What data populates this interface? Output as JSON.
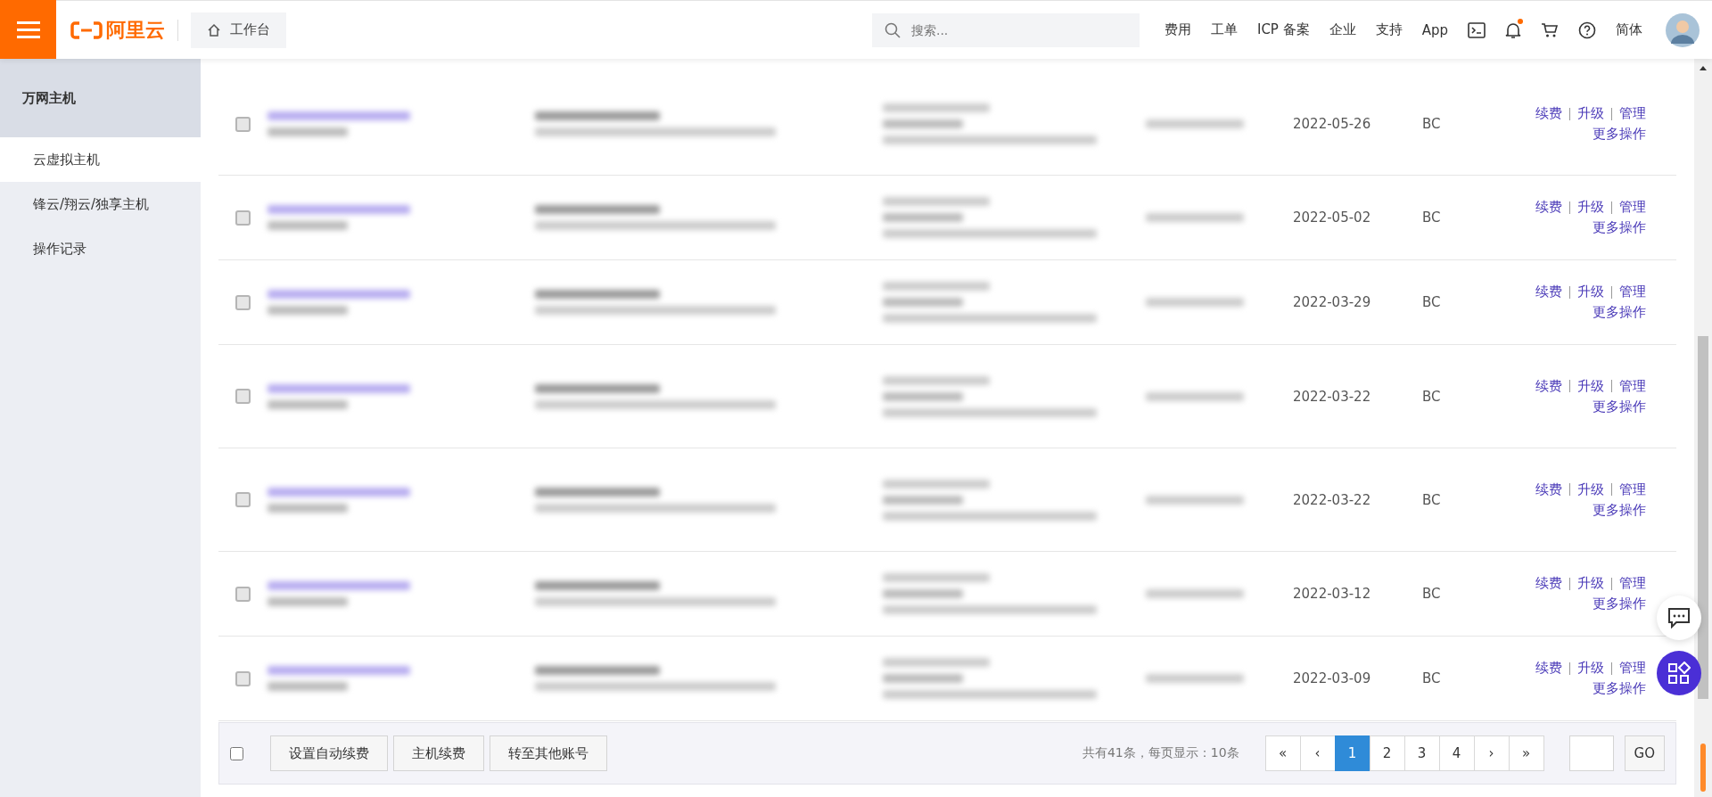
{
  "header": {
    "logo": "阿里云",
    "workbench": "工作台",
    "search": {
      "placeholder": "搜索..."
    },
    "nav": [
      {
        "kind": "text",
        "label": "费用"
      },
      {
        "kind": "text",
        "label": "工单"
      },
      {
        "kind": "text",
        "label": "ICP 备案"
      },
      {
        "kind": "text",
        "label": "企业"
      },
      {
        "kind": "text",
        "label": "支持"
      },
      {
        "kind": "text",
        "label": "App"
      },
      {
        "kind": "terminal"
      },
      {
        "kind": "bell",
        "unread": true
      },
      {
        "kind": "cart"
      },
      {
        "kind": "help"
      },
      {
        "kind": "text",
        "label": "简体"
      },
      {
        "kind": "avatar"
      }
    ]
  },
  "sidebar": {
    "title": "万网主机",
    "items": [
      {
        "label": "云虚拟主机",
        "selected": true
      },
      {
        "label": "锋云/翔云/独享主机",
        "selected": false
      },
      {
        "label": "操作记录",
        "selected": false
      }
    ]
  },
  "rows": [
    {
      "checked": false,
      "date": "2022-05-26",
      "type": "BC",
      "actions": [
        "续费",
        "升级",
        "管理"
      ],
      "more": "更多操作"
    },
    {
      "checked": false,
      "date": "2022-05-02",
      "type": "BC",
      "actions": [
        "续费",
        "升级",
        "管理"
      ],
      "more": "更多操作"
    },
    {
      "checked": false,
      "date": "2022-03-29",
      "type": "BC",
      "actions": [
        "续费",
        "升级",
        "管理"
      ],
      "more": "更多操作"
    },
    {
      "checked": false,
      "date": "2022-03-22",
      "type": "BC",
      "actions": [
        "续费",
        "升级",
        "管理"
      ],
      "more": "更多操作"
    },
    {
      "checked": false,
      "date": "2022-03-22",
      "type": "BC",
      "actions": [
        "续费",
        "升级",
        "管理"
      ],
      "more": "更多操作"
    },
    {
      "checked": false,
      "date": "2022-03-12",
      "type": "BC",
      "actions": [
        "续费",
        "升级",
        "管理"
      ],
      "more": "更多操作"
    },
    {
      "checked": false,
      "date": "2022-03-09",
      "type": "BC",
      "actions": [
        "续费",
        "升级",
        "管理"
      ],
      "more": "更多操作"
    }
  ],
  "footer": {
    "select_all": {
      "checked": false
    },
    "buttons": [
      "设置自动续费",
      "主机续费",
      "转至其他账号"
    ],
    "summary": "共有41条，每页显示：10条",
    "pages": [
      {
        "label": "«",
        "selected": false
      },
      {
        "label": "‹",
        "selected": false
      },
      {
        "label": "1",
        "selected": true
      },
      {
        "label": "2",
        "selected": false
      },
      {
        "label": "3",
        "selected": false
      },
      {
        "label": "4",
        "selected": false
      },
      {
        "label": "›",
        "selected": false
      },
      {
        "label": "»",
        "selected": false
      }
    ],
    "go": "GO"
  }
}
